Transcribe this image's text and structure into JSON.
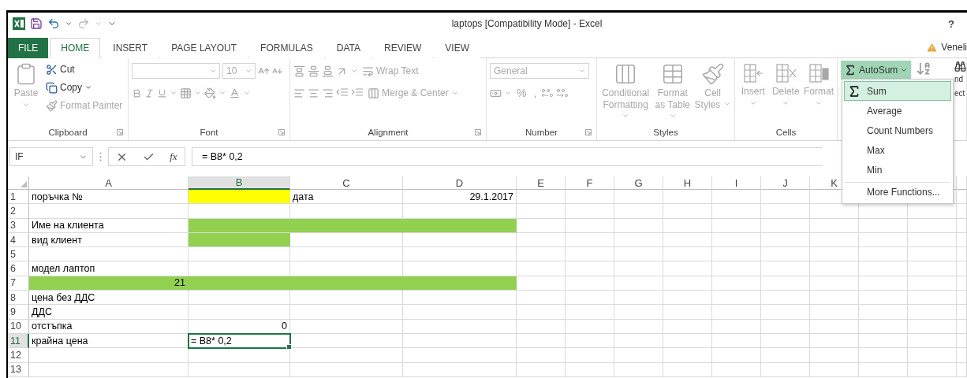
{
  "title_bar": {
    "title": "laptops  [Compatibility Mode] - Excel",
    "help": "?"
  },
  "tabs": [
    {
      "label": "FILE",
      "kind": "file",
      "selected": false
    },
    {
      "label": "HOME",
      "kind": "tab",
      "selected": true
    },
    {
      "label": "INSERT",
      "kind": "tab",
      "selected": false
    },
    {
      "label": "PAGE LAYOUT",
      "kind": "tab",
      "selected": false
    },
    {
      "label": "FORMULAS",
      "kind": "tab",
      "selected": false
    },
    {
      "label": "DATA",
      "kind": "tab",
      "selected": false
    },
    {
      "label": "REVIEW",
      "kind": "tab",
      "selected": false
    },
    {
      "label": "VIEW",
      "kind": "tab",
      "selected": false
    }
  ],
  "account": {
    "name": "Veneli",
    "warning": true
  },
  "ribbon": {
    "clipboard": {
      "label": "Clipboard",
      "paste": {
        "label": "Paste",
        "disabled": true
      },
      "commands": [
        {
          "label": "Cut",
          "kind": "cut",
          "disabled": false
        },
        {
          "label": "Copy",
          "kind": "copy",
          "disabled": false
        },
        {
          "label": "Format Painter",
          "kind": "painter",
          "disabled": true
        }
      ]
    },
    "font": {
      "label": "Font",
      "disabled": true,
      "size": "10"
    },
    "alignment": {
      "label": "Alignment",
      "disabled": true,
      "wrap_text": "Wrap Text",
      "merge": "Merge & Center"
    },
    "number": {
      "label": "Number",
      "disabled": true,
      "format": "General",
      "percent": "%",
      "comma": ","
    },
    "styles": {
      "label": "Styles",
      "disabled": true,
      "commands": [
        {
          "label": "Conditional Formatting",
          "kind": "conditional"
        },
        {
          "label": "Format as Table",
          "kind": "table"
        },
        {
          "label": "Cell Styles",
          "kind": "cellstyles"
        }
      ]
    },
    "cells": {
      "label": "Cells",
      "disabled": true,
      "commands": [
        {
          "label": "Insert",
          "kind": "insert"
        },
        {
          "label": "Delete",
          "kind": "delete"
        },
        {
          "label": "Format",
          "kind": "format"
        }
      ]
    },
    "editing": {
      "autosum": {
        "label": "AutoSum",
        "expanded": true
      },
      "cut_texts": [
        "nd",
        "ect"
      ]
    }
  },
  "formula_bar": {
    "name_box": "IF",
    "function_label": "fx",
    "formula": "= B8* 0,2"
  },
  "sheet": {
    "columns": [
      {
        "label": "A",
        "selected": false
      },
      {
        "label": "B",
        "selected": true
      },
      {
        "label": "C",
        "selected": false
      },
      {
        "label": "D",
        "selected": false
      },
      {
        "label": "E",
        "selected": false
      },
      {
        "label": "F",
        "selected": false
      },
      {
        "label": "G",
        "selected": false
      },
      {
        "label": "H",
        "selected": false
      },
      {
        "label": "I",
        "selected": false
      },
      {
        "label": "J",
        "selected": false
      },
      {
        "label": "K",
        "selected": false
      }
    ],
    "rows": [
      {
        "label": "1",
        "selected": false,
        "cells": [
          {
            "text": "поръчка №",
            "kind": "text",
            "active": false
          },
          {
            "color": "#ffff00",
            "active": false
          },
          {
            "text": "дата",
            "kind": "text",
            "active": false
          },
          {
            "text": "29.1.2017",
            "kind": "number",
            "active": false
          }
        ]
      },
      {
        "label": "2",
        "selected": false,
        "cells": [
          {
            "active": false
          },
          {
            "active": false
          },
          {
            "active": false
          },
          {
            "active": false
          }
        ]
      },
      {
        "label": "3",
        "selected": false,
        "cells": [
          {
            "text": "Име на клиента",
            "kind": "text",
            "active": false
          },
          {
            "color": "#92d050",
            "active": false
          },
          {
            "color": "#92d050",
            "active": false
          },
          {
            "color": "#92d050",
            "active": false
          }
        ]
      },
      {
        "label": "4",
        "selected": false,
        "cells": [
          {
            "text": "вид клиент",
            "kind": "text",
            "active": false
          },
          {
            "color": "#92d050",
            "active": false
          },
          {
            "active": false
          },
          {
            "active": false
          }
        ]
      },
      {
        "label": "5",
        "selected": false,
        "cells": [
          {
            "active": false
          },
          {
            "active": false
          },
          {
            "active": false
          },
          {
            "active": false
          }
        ]
      },
      {
        "label": "6",
        "selected": false,
        "cells": [
          {
            "text": "модел лаптоп",
            "kind": "text",
            "active": false
          },
          {
            "active": false
          },
          {
            "active": false
          },
          {
            "active": false
          }
        ]
      },
      {
        "label": "7",
        "selected": false,
        "cells": [
          {
            "text": "21",
            "kind": "number",
            "color": "#92d050",
            "active": false
          },
          {
            "color": "#92d050",
            "active": false
          },
          {
            "color": "#92d050",
            "active": false
          },
          {
            "color": "#92d050",
            "active": false
          }
        ]
      },
      {
        "label": "8",
        "selected": false,
        "cells": [
          {
            "text": "цена без ДДС",
            "kind": "text",
            "active": false
          },
          {
            "active": false
          },
          {
            "active": false
          },
          {
            "active": false
          }
        ]
      },
      {
        "label": "9",
        "selected": false,
        "cells": [
          {
            "text": "ДДС",
            "kind": "text",
            "active": false
          },
          {
            "active": false
          },
          {
            "active": false
          },
          {
            "active": false
          }
        ]
      },
      {
        "label": "10",
        "selected": false,
        "cells": [
          {
            "text": "отстъпка",
            "kind": "text",
            "active": false
          },
          {
            "text": "0",
            "kind": "number",
            "active": false
          },
          {
            "active": false
          },
          {
            "active": false
          }
        ]
      },
      {
        "label": "11",
        "selected": true,
        "cells": [
          {
            "text": "крайна цена",
            "kind": "text",
            "active": false
          },
          {
            "text": "= B8* 0,2",
            "kind": "text",
            "active": true
          },
          {
            "active": false
          },
          {
            "active": false
          }
        ]
      },
      {
        "label": "12",
        "selected": false,
        "cells": [
          {
            "active": false
          },
          {
            "active": false
          },
          {
            "active": false
          },
          {
            "active": false
          }
        ]
      },
      {
        "label": "13",
        "selected": false,
        "cells": [
          {
            "active": false
          },
          {
            "active": false
          },
          {
            "active": false
          },
          {
            "active": false
          }
        ]
      }
    ]
  },
  "autosum_menu": {
    "items": [
      {
        "label": "Sum",
        "selected": true,
        "divider": false,
        "kind": "sum"
      },
      {
        "label": "Average",
        "selected": false,
        "divider": false,
        "kind": "plain"
      },
      {
        "label": "Count Numbers",
        "selected": false,
        "divider": false,
        "kind": "plain"
      },
      {
        "label": "Max",
        "selected": false,
        "divider": false,
        "kind": "plain"
      },
      {
        "label": "Min",
        "selected": false,
        "divider": false,
        "kind": "plain"
      },
      {
        "label": "More Functions...",
        "selected": false,
        "divider": true,
        "kind": "plain"
      }
    ]
  }
}
